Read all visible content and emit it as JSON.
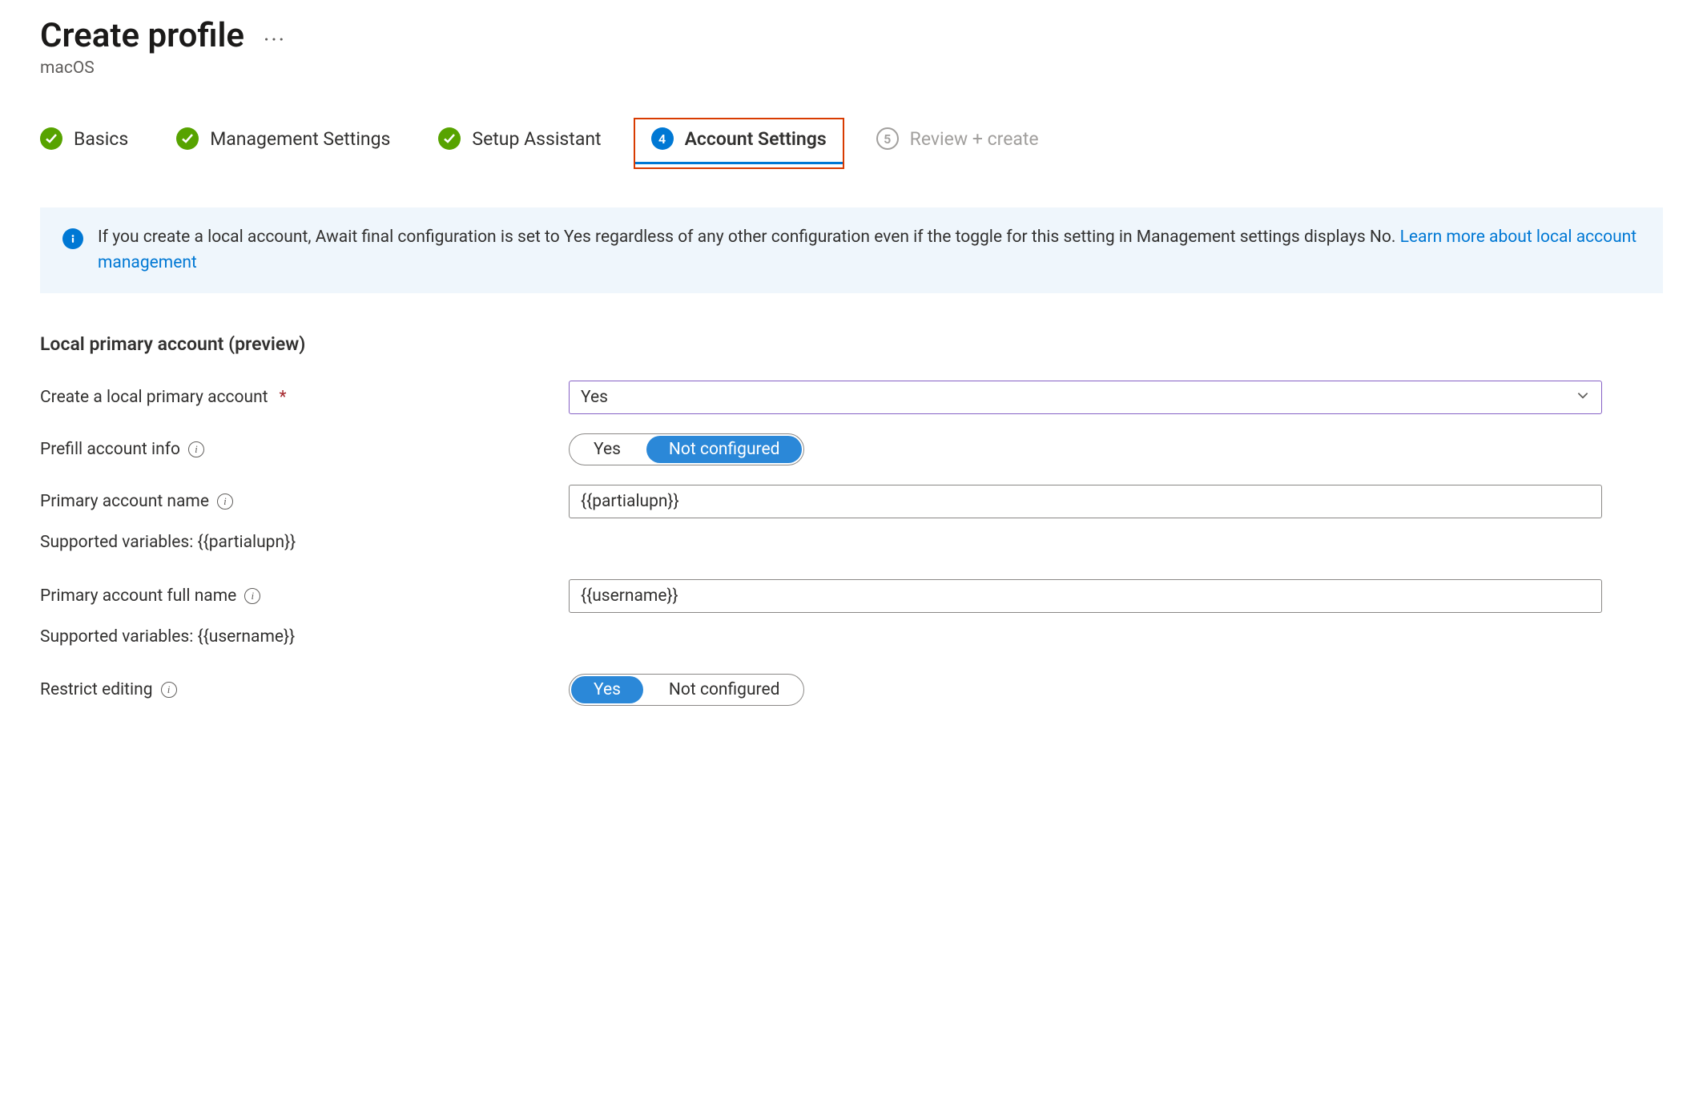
{
  "header": {
    "title": "Create profile",
    "subtitle": "macOS"
  },
  "stepper": {
    "steps": [
      {
        "label": "Basics",
        "state": "complete"
      },
      {
        "label": "Management Settings",
        "state": "complete"
      },
      {
        "label": "Setup Assistant",
        "state": "complete"
      },
      {
        "label": "Account Settings",
        "state": "current",
        "number": "4"
      },
      {
        "label": "Review + create",
        "state": "pending",
        "number": "5"
      }
    ]
  },
  "banner": {
    "text": "If you create a local account, Await final configuration is set to Yes regardless of any other configuration even if the toggle for this setting in Management settings displays No. ",
    "link_text": "Learn more about local account management"
  },
  "section": {
    "title": "Local primary account (preview)"
  },
  "fields": {
    "create_local": {
      "label": "Create a local primary account",
      "value": "Yes"
    },
    "prefill": {
      "label": "Prefill account info",
      "yes": "Yes",
      "not_configured": "Not configured",
      "selected": "not_configured"
    },
    "primary_name": {
      "label": "Primary account name",
      "value": "{{partialupn}}",
      "hint": "Supported variables: {{partialupn}}"
    },
    "full_name": {
      "label": "Primary account full name",
      "value": "{{username}}",
      "hint": "Supported variables: {{username}}"
    },
    "restrict": {
      "label": "Restrict editing",
      "yes": "Yes",
      "not_configured": "Not configured",
      "selected": "yes"
    }
  }
}
